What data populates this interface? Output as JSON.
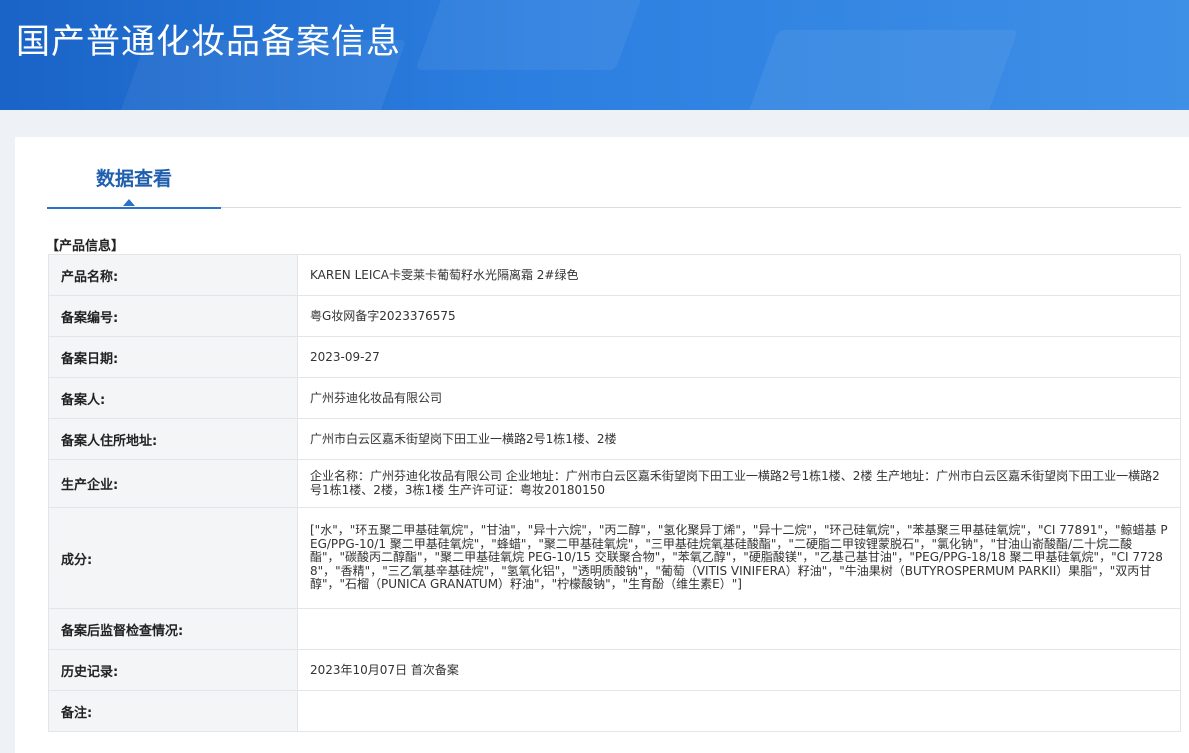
{
  "header": {
    "title": "国产普通化妆品备案信息"
  },
  "tabs": {
    "active_label": "数据查看"
  },
  "section": {
    "title": "【产品信息】"
  },
  "rows": [
    {
      "label": "产品名称:",
      "value": "KAREN LEICA卡雯莱卡葡萄籽水光隔离霜 2#绿色"
    },
    {
      "label": "备案编号:",
      "value": "粤G妆网备字2023376575"
    },
    {
      "label": "备案日期:",
      "value": "2023-09-27"
    },
    {
      "label": "备案人:",
      "value": "广州芬迪化妆品有限公司"
    },
    {
      "label": "备案人住所地址:",
      "value": "广州市白云区嘉禾街望岗下田工业一横路2号1栋1楼、2楼"
    },
    {
      "label": "生产企业:",
      "value": "企业名称：广州芬迪化妆品有限公司 企业地址：广州市白云区嘉禾街望岗下田工业一横路2号1栋1楼、2楼 生产地址：广州市白云区嘉禾街望岗下田工业一横路2号1栋1楼、2楼，3栋1楼 生产许可证：粤妆20180150"
    },
    {
      "label": "成分:",
      "value": "[\"水\"，\"环五聚二甲基硅氧烷\"，\"甘油\"，\"异十六烷\"，\"丙二醇\"，\"氢化聚异丁烯\"，\"异十二烷\"，\"环己硅氧烷\"，\"苯基聚三甲基硅氧烷\"，\"CI 77891\"，\"鲸蜡基 PEG/PPG-10/1 聚二甲基硅氧烷\"，\"蜂蜡\"，\"聚二甲基硅氧烷\"，\"三甲基硅烷氧基硅酸酯\"，\"二硬脂二甲铵锂蒙脱石\"，\"氯化钠\"，\"甘油山嵛酸酯/二十烷二酸酯\"，\"碳酸丙二醇酯\"，\"聚二甲基硅氧烷 PEG-10/15 交联聚合物\"，\"苯氧乙醇\"，\"硬脂酸镁\"，\"乙基己基甘油\"，\"PEG/PPG-18/18 聚二甲基硅氧烷\"，\"CI 77288\"，\"香精\"，\"三乙氧基辛基硅烷\"，\"氢氧化铝\"，\"透明质酸钠\"，\"葡萄（VITIS VINIFERA）籽油\"，\"牛油果树（BUTYROSPERMUM PARKII）果脂\"，\"双丙甘醇\"，\"石榴（PUNICA GRANATUM）籽油\"，\"柠檬酸钠\"，\"生育酚（维生素E）\"]"
    },
    {
      "label": "备案后监督检查情况:",
      "value": ""
    },
    {
      "label": "历史记录:",
      "value": "2023年10月07日 首次备案"
    },
    {
      "label": "备注:",
      "value": ""
    }
  ]
}
